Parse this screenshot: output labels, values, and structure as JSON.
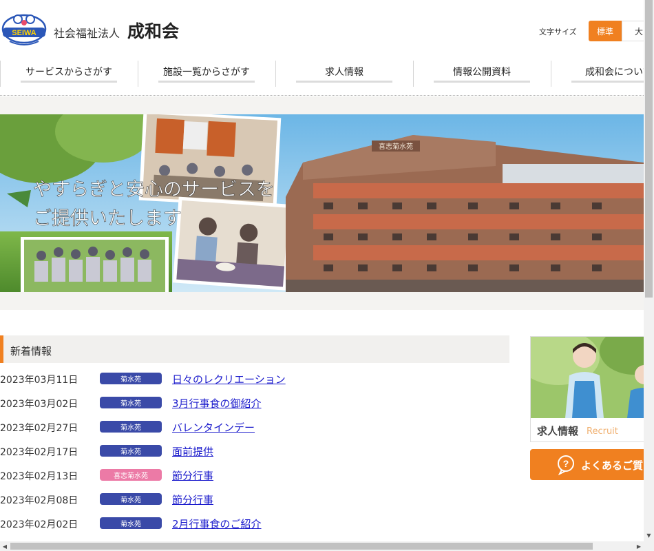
{
  "header": {
    "logo_text": "SEIWA",
    "org_prefix": "社会福祉法人",
    "org_name": "成和会",
    "font_size_label": "文字サイズ",
    "font_size_options": [
      "標準",
      "大"
    ]
  },
  "nav": {
    "items": [
      {
        "label": "サービスからさがす"
      },
      {
        "label": "施設一覧からさがす"
      },
      {
        "label": "求人情報"
      },
      {
        "label": "情報公開資料"
      },
      {
        "label": "成和会について"
      }
    ]
  },
  "hero": {
    "caption_line1": "やすらぎと安心のサービスを",
    "caption_line2": "ご提供いたします",
    "building_sign": "喜志菊水苑"
  },
  "news": {
    "heading": "新着情報",
    "items": [
      {
        "date": "2023年03月11日",
        "tag": "菊水苑",
        "tag_color": "blue",
        "title": "日々のレクリエーション"
      },
      {
        "date": "2023年03月02日",
        "tag": "菊水苑",
        "tag_color": "blue",
        "title": "3月行事食の御紹介"
      },
      {
        "date": "2023年02月27日",
        "tag": "菊水苑",
        "tag_color": "blue",
        "title": "バレンタインデー"
      },
      {
        "date": "2023年02月17日",
        "tag": "菊水苑",
        "tag_color": "blue",
        "title": "面前提供"
      },
      {
        "date": "2023年02月13日",
        "tag": "喜志菊水苑",
        "tag_color": "pink",
        "title": "節分行事"
      },
      {
        "date": "2023年02月08日",
        "tag": "菊水苑",
        "tag_color": "blue",
        "title": "節分行事"
      },
      {
        "date": "2023年02月02日",
        "tag": "菊水苑",
        "tag_color": "blue",
        "title": "2月行事食のご紹介"
      }
    ]
  },
  "side": {
    "recruit_label": "求人情報",
    "recruit_en": "Recruit",
    "faq_label": "よくあるご質問"
  },
  "colors": {
    "accent": "#f08020",
    "tag_blue": "#3a4aa8",
    "tag_pink": "#ec7aa6",
    "link": "#1a1acc"
  }
}
